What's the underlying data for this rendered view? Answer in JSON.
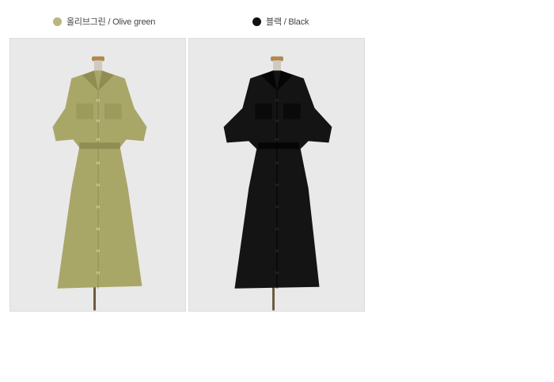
{
  "variants": [
    {
      "label": "올리브그린 / Olive green",
      "swatch_color": "#b9b77f",
      "dress_color": "#a9a768",
      "dress_shade": "#8f8d52"
    },
    {
      "label": "블랙 / Black",
      "swatch_color": "#111111",
      "dress_color": "#141414",
      "dress_shade": "#050505"
    }
  ]
}
